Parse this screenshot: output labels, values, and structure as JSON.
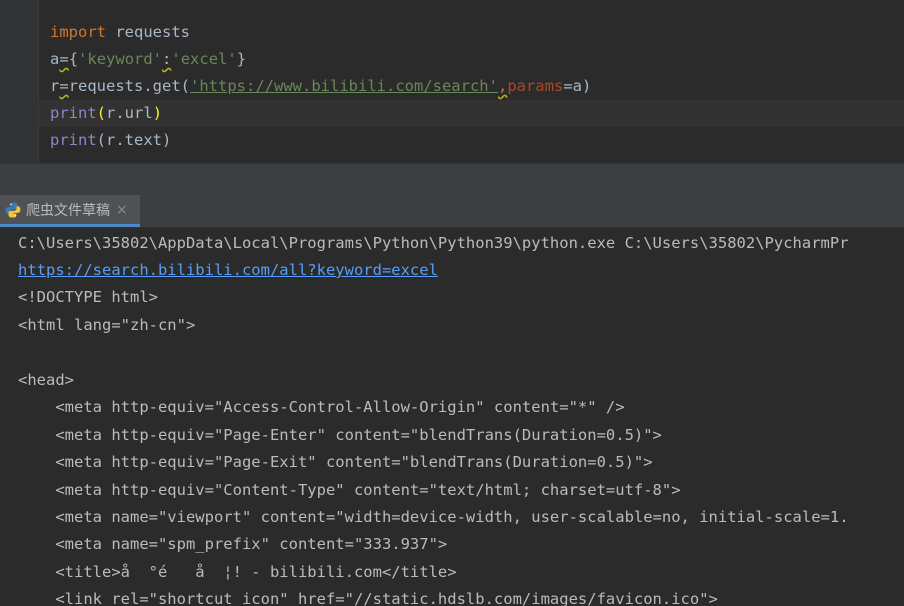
{
  "editor": {
    "line1": {
      "kw": "import",
      "rest": " requests"
    },
    "line2": {
      "a": "a",
      "eq": "=",
      "ob": "{",
      "key": "'keyword'",
      "colon": ":",
      "val": "'excel'",
      "cb": "}"
    },
    "line3": {
      "r": "r",
      "eq": "=",
      "call": "requests.get(",
      "url": "'https://www.bilibili.com/search'",
      "comma": ",",
      "param": "params",
      "rest": "=a)"
    },
    "line4": {
      "fn": "print",
      "op": "(",
      "arg": "r.url",
      "cp": ")"
    },
    "line5": {
      "fn": "print",
      "op": "(",
      "arg": "r.text",
      "cp": ")"
    }
  },
  "run_tab": {
    "label": "爬虫文件草稿",
    "close": "×",
    "icon": "python-icon"
  },
  "console": {
    "lines": [
      {
        "text": "C:\\Users\\35802\\AppData\\Local\\Programs\\Python\\Python39\\python.exe C:\\Users\\35802\\PycharmPr"
      },
      {
        "text": "https://search.bilibili.com/all?keyword=excel",
        "link": true
      },
      {
        "text": "<!DOCTYPE html>"
      },
      {
        "text": "<html lang=\"zh-cn\">"
      },
      {
        "text": ""
      },
      {
        "text": "<head>"
      },
      {
        "text": "    <meta http-equiv=\"Access-Control-Allow-Origin\" content=\"*\" />"
      },
      {
        "text": "    <meta http-equiv=\"Page-Enter\" content=\"blendTrans(Duration=0.5)\">"
      },
      {
        "text": "    <meta http-equiv=\"Page-Exit\" content=\"blendTrans(Duration=0.5)\">"
      },
      {
        "text": "    <meta http-equiv=\"Content-Type\" content=\"text/html; charset=utf-8\">"
      },
      {
        "text": "    <meta name=\"viewport\" content=\"width=device-width, user-scalable=no, initial-scale=1."
      },
      {
        "text": "    <meta name=\"spm_prefix\" content=\"333.937\">"
      },
      {
        "text": "    <title>å  °é   å  ¦! - bilibili.com</title>"
      },
      {
        "text": "    <link rel=\"shortcut icon\" href=\"//static.hdslb.com/images/favicon.ico\">"
      }
    ]
  },
  "colors": {
    "editor_bg": "#2b2b2b",
    "keyword": "#cc7832",
    "string": "#6a8759",
    "builtin": "#8888c6",
    "link": "#589df6"
  }
}
